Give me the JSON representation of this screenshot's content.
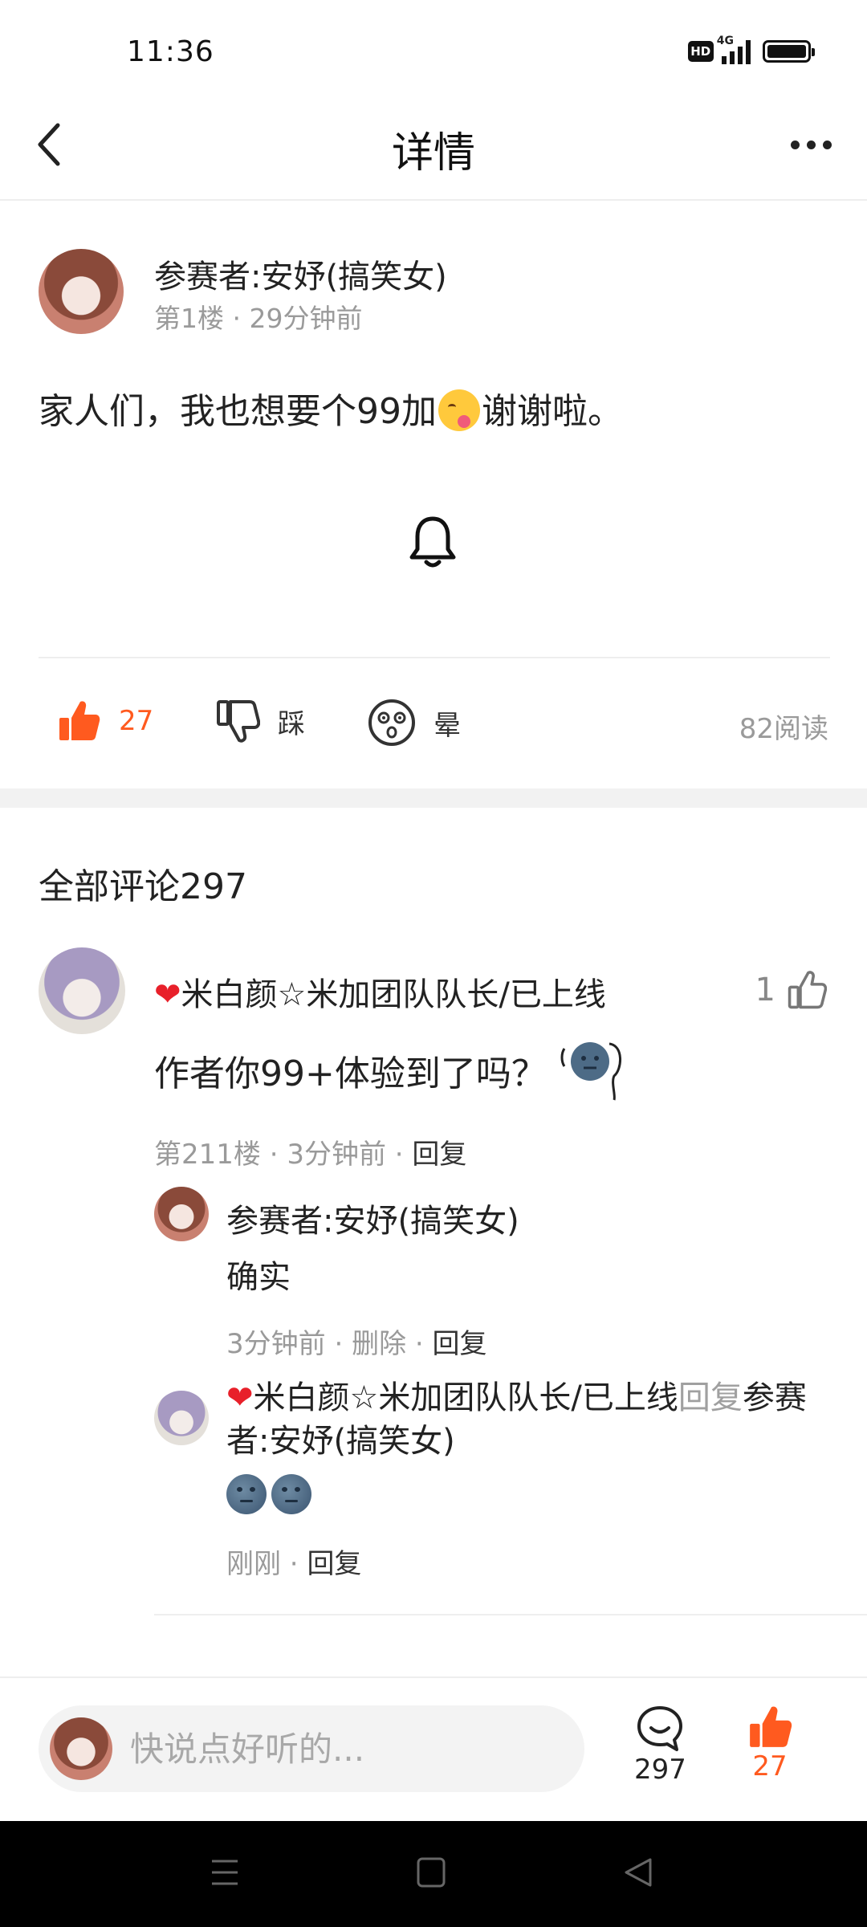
{
  "status_bar": {
    "time": "11:36",
    "network": "4G",
    "hd": "HD"
  },
  "header": {
    "title": "详情"
  },
  "post": {
    "author": "参赛者:安妤(搞笑女)",
    "floor": "第1楼",
    "time": "29分钟前",
    "text_before_emoji": "家人们，我也想要个99加",
    "text_after_emoji": "谢谢啦。",
    "likes": "27",
    "dislike_label": "踩",
    "dizzy_label": "晕",
    "reads": "82阅读"
  },
  "comments": {
    "title": "全部评论297",
    "items": [
      {
        "author": "米白颜☆米加团队队长/已上线",
        "likes": "1",
        "text": "作者你99+体验到了吗？",
        "floor": "第211楼",
        "time": "3分钟前",
        "reply_label": "回复",
        "replies": [
          {
            "author": "参赛者:安妤(搞笑女)",
            "text": "确实",
            "time": "3分钟前",
            "delete_label": "删除",
            "reply_label": "回复"
          },
          {
            "author": "米白颜☆米加团队队长/已上线",
            "reply_word": "回复",
            "target": "参赛者:安妤(搞笑女)",
            "time": "刚刚",
            "reply_label": "回复"
          }
        ]
      }
    ]
  },
  "bottom_bar": {
    "input_placeholder": "快说点好听的...",
    "comment_count": "297",
    "like_count": "27"
  },
  "colors": {
    "accent": "#ff5a1f",
    "heart": "#e8202a",
    "muted": "#9a9a9a"
  },
  "icons": [
    "back-icon",
    "more-icon",
    "bell-icon",
    "thumbs-up-icon",
    "thumbs-down-icon",
    "dizzy-face-icon",
    "comment-bubble-icon",
    "menu-nav-icon",
    "home-nav-icon",
    "back-nav-icon"
  ]
}
